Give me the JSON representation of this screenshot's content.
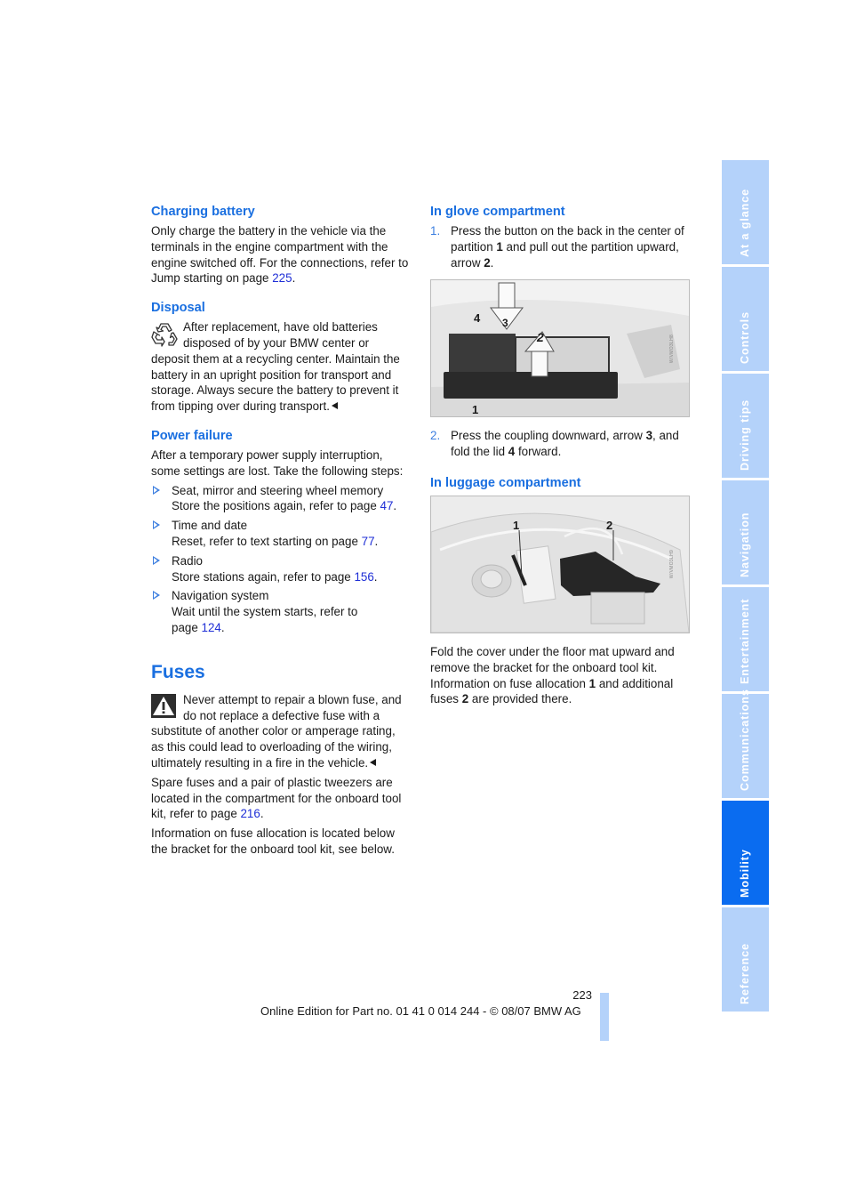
{
  "left_column": {
    "charging_battery": {
      "heading": "Charging battery",
      "text": "Only charge the battery in the vehicle via the terminals in the engine compartment with the engine switched off. For the connections, refer to Jump starting on page ",
      "link": "225",
      "after": "."
    },
    "disposal": {
      "heading": "Disposal",
      "icon": "recycle-icon",
      "text": "After replacement, have old batteries disposed of by your BMW center or deposit them at a recycling center. Maintain the battery in an upright position for transport and storage. Always secure the battery to prevent it from tipping over during transport."
    },
    "power_failure": {
      "heading": "Power failure",
      "intro": "After a temporary power supply interruption, some settings are lost. Take the following steps:",
      "items": [
        {
          "title": "Seat, mirror and steering wheel memory",
          "text": "Store the positions again, refer to page ",
          "link": "47",
          "after": "."
        },
        {
          "title": "Time and date",
          "text": "Reset, refer to text starting on page ",
          "link": "77",
          "after": "."
        },
        {
          "title": "Radio",
          "text": "Store stations again, refer to page ",
          "link": "156",
          "after": "."
        },
        {
          "title": "Navigation system",
          "text": "Wait until the system starts, refer to page ",
          "link": "124",
          "after": "."
        }
      ]
    },
    "fuses": {
      "heading": "Fuses",
      "icon": "warning-icon",
      "warning": "Never attempt to repair a blown fuse, and do not replace a defective fuse with a substitute of another color or amperage rating, as this could lead to overloading of the wiring, ultimately resulting in a fire in the vehicle.",
      "spare_text": "Spare fuses and a pair of plastic tweezers are located in the compartment for the onboard tool kit, refer to page ",
      "spare_link": "216",
      "spare_after": ".",
      "info": "Information on fuse allocation is located below the bracket for the onboard tool kit, see below."
    }
  },
  "right_column": {
    "glove": {
      "heading": "In glove compartment",
      "steps": [
        {
          "num": "1.",
          "pre": "Press the button on the back in the center of partition ",
          "b1": "1",
          "mid": " and pull out the partition upward, arrow ",
          "b2": "2",
          "post": "."
        },
        {
          "num": "2.",
          "pre": "Press the coupling downward, arrow ",
          "b1": "3",
          "mid": ", and fold the lid ",
          "b2": "4",
          "post": " forward."
        }
      ],
      "photo_labels": [
        "1",
        "2",
        "3",
        "4"
      ],
      "photo_code": "W/VMO3LH8"
    },
    "luggage": {
      "heading": "In luggage compartment",
      "photo_labels": [
        "1",
        "2"
      ],
      "photo_code": "W/VMO3LH9",
      "text_pre": "Fold the cover under the floor mat upward and remove the bracket for the onboard tool kit. Information on fuse allocation ",
      "b1": "1",
      "text_mid": " and additional fuses ",
      "b2": "2",
      "text_post": " are provided there."
    }
  },
  "side_tabs": [
    {
      "label": "At a glance",
      "active": false
    },
    {
      "label": "Controls",
      "active": false
    },
    {
      "label": "Driving tips",
      "active": false
    },
    {
      "label": "Navigation",
      "active": false
    },
    {
      "label": "Entertainment",
      "active": false
    },
    {
      "label": "Communications",
      "active": false
    },
    {
      "label": "Mobility",
      "active": true
    },
    {
      "label": "Reference",
      "active": false
    }
  ],
  "footer": {
    "page_number": "223",
    "edition": "Online Edition for Part no. 01 41 0 014 244 - © 08/07 BMW AG"
  },
  "colors": {
    "heading_blue": "#1a6fe0",
    "link_blue": "#1f2fd6",
    "tab_inactive": "#b4d2fa",
    "tab_active": "#0a6cf0"
  }
}
